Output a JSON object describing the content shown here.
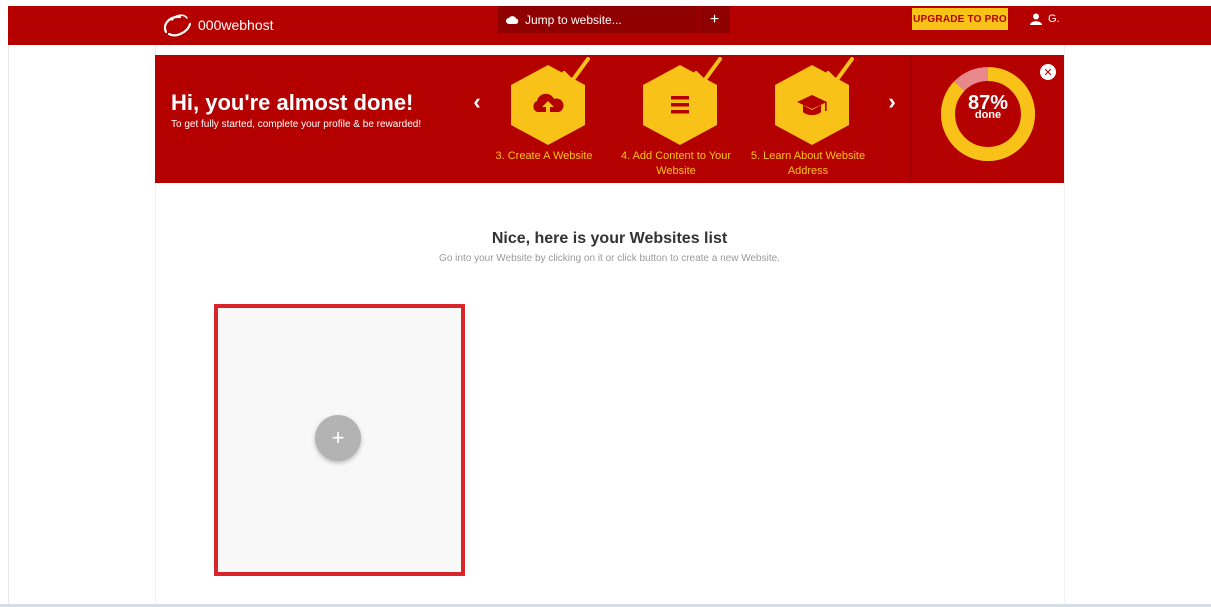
{
  "header": {
    "logo_text": "000webhost",
    "jump_label": "Jump to website...",
    "jump_add": "+",
    "upgrade_label": "UPGRADE TO PRO",
    "user_name": "G."
  },
  "banner": {
    "title": "Hi, you're almost done!",
    "subtitle": "To get fully started, complete your profile & be rewarded!",
    "prev_arrow": "‹",
    "next_arrow": "›",
    "steps": [
      {
        "label": "3. Create A Website",
        "icon": "cloud-upload-icon"
      },
      {
        "label": "4. Add Content to Your Website",
        "icon": "menu-lines-icon"
      },
      {
        "label": "5. Learn About Website Address",
        "icon": "graduation-cap-icon"
      }
    ],
    "progress_percent": 87,
    "progress_label": "87%",
    "progress_done": "done",
    "close": "✕"
  },
  "main": {
    "title": "Nice, here is your Websites list",
    "subtitle": "Go into your Website by clicking on it or click button to create a new Website.",
    "add_symbol": "+"
  },
  "colors": {
    "brand_red": "#b50000",
    "accent_yellow": "#f9c218",
    "highlight_red": "#d9252a"
  }
}
